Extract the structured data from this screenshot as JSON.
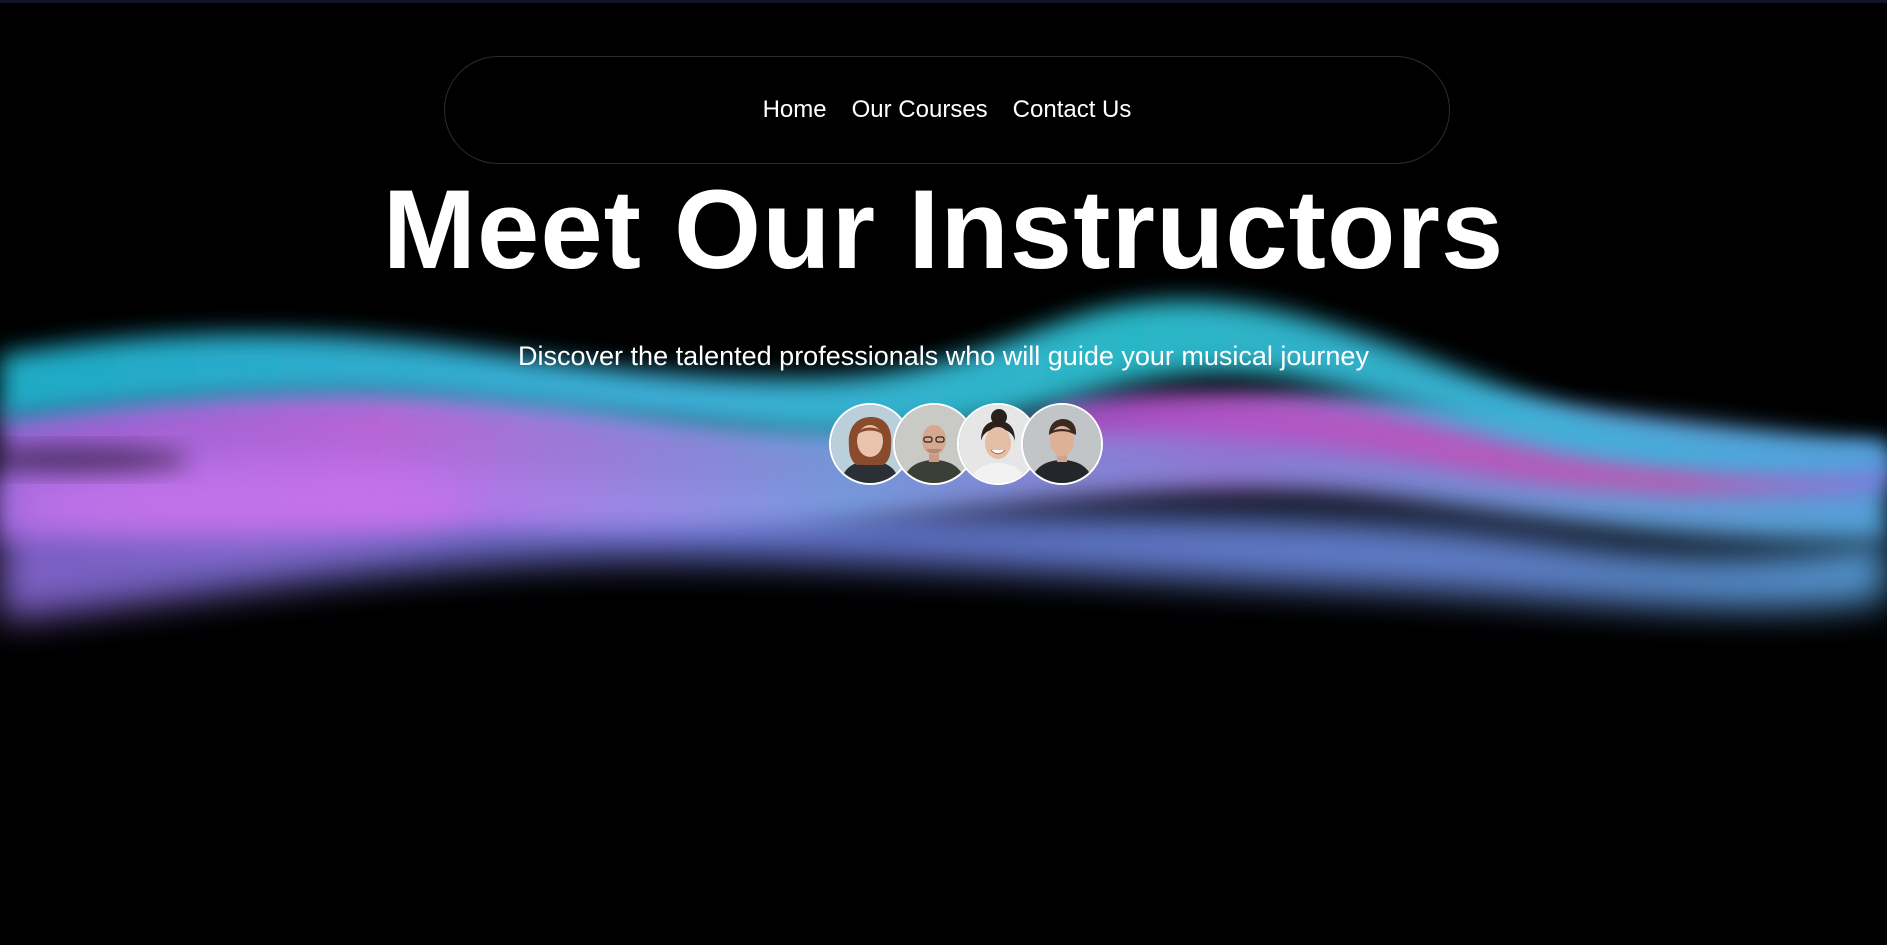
{
  "nav": {
    "items": [
      {
        "label": "Home"
      },
      {
        "label": "Our Courses"
      },
      {
        "label": "Contact Us"
      }
    ]
  },
  "hero": {
    "title": "Meet Our Instructors",
    "subtitle": "Discover the talented professionals who will guide your musical journey"
  },
  "instructors": [
    {
      "avatar": "instructor-photo-1"
    },
    {
      "avatar": "instructor-photo-2"
    },
    {
      "avatar": "instructor-photo-3"
    },
    {
      "avatar": "instructor-photo-4"
    }
  ],
  "colors": {
    "background": "#000000",
    "text": "#ffffff",
    "nav_border": "#2c2c2c",
    "aurora_cyan": "#22b6d2",
    "aurora_blue": "#66a8e8",
    "aurora_violet": "#c06ce6",
    "aurora_pink": "#d14fb0"
  }
}
